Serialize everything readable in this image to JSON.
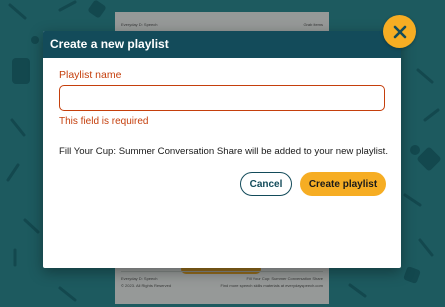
{
  "background": {
    "doc_header_left": "Everyday D: Speech",
    "doc_header_right": "Grab items",
    "doc_footer_left_1": "Everyday D: Speech",
    "doc_footer_left_2": "© 2023. All Rights Reserved",
    "doc_footer_right_1": "Fill Your Cup: Summer Conversation Share",
    "doc_footer_right_2": "Find more speech skills materials at everydayspeech.com"
  },
  "dialog": {
    "title": "Create a new playlist",
    "field_label": "Playlist name",
    "field_value": "",
    "field_placeholder": "",
    "error_message": "This field is required",
    "info_message": "Fill Your Cup: Summer Conversation Share will be added to your new playlist.",
    "cancel_label": "Cancel",
    "create_label": "Create playlist"
  },
  "close_button": {
    "icon": "close-icon"
  },
  "colors": {
    "header_bg": "#134b5a",
    "accent_orange": "#f6ad23",
    "error_red": "#c53f0c",
    "backdrop_teal": "#2d8a93"
  }
}
